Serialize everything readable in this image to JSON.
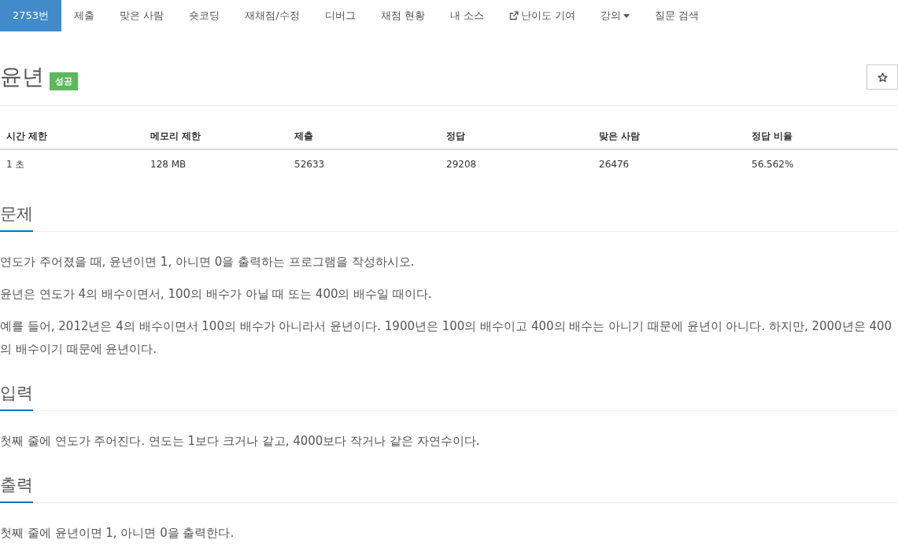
{
  "nav": {
    "items": [
      {
        "label": "2753번",
        "selected": true,
        "kind": "plain"
      },
      {
        "label": "제출",
        "selected": false,
        "kind": "plain"
      },
      {
        "label": "맞은 사람",
        "selected": false,
        "kind": "plain"
      },
      {
        "label": "숏코딩",
        "selected": false,
        "kind": "plain"
      },
      {
        "label": "재채점/수정",
        "selected": false,
        "kind": "plain"
      },
      {
        "label": "디버그",
        "selected": false,
        "kind": "plain"
      },
      {
        "label": "채점 현황",
        "selected": false,
        "kind": "plain"
      },
      {
        "label": "내 소스",
        "selected": false,
        "kind": "plain"
      },
      {
        "label": "난이도 기여",
        "selected": false,
        "kind": "external"
      },
      {
        "label": "강의",
        "selected": false,
        "kind": "dropdown"
      },
      {
        "label": "질문 검색",
        "selected": false,
        "kind": "plain"
      }
    ]
  },
  "problem": {
    "title": "윤년",
    "badge": "성공"
  },
  "info_table": {
    "columns": [
      "시간 제한",
      "메모리 제한",
      "제출",
      "정답",
      "맞은 사람",
      "정답 비율"
    ],
    "rows": [
      [
        "1 초",
        "128 MB",
        "52633",
        "29208",
        "26476",
        "56.562%"
      ]
    ]
  },
  "sections": [
    {
      "heading": "문제",
      "paragraphs": [
        "연도가 주어졌을 때, 윤년이면 1, 아니면 0을 출력하는 프로그램을 작성하시오.",
        "윤년은 연도가 4의 배수이면서, 100의 배수가 아닐 때 또는 400의 배수일 때이다.",
        "예를 들어, 2012년은 4의 배수이면서 100의 배수가 아니라서 윤년이다. 1900년은 100의 배수이고 400의 배수는 아니기 때문에 윤년이 아니다. 하지만, 2000년은 400의 배수이기 때문에 윤년이다."
      ]
    },
    {
      "heading": "입력",
      "paragraphs": [
        "첫째 줄에 연도가 주어진다. 연도는 1보다 크거나 같고, 4000보다 작거나 같은 자연수이다."
      ]
    },
    {
      "heading": "출력",
      "paragraphs": [
        "첫째 줄에 윤년이면 1, 아니면 0을 출력한다."
      ]
    }
  ]
}
